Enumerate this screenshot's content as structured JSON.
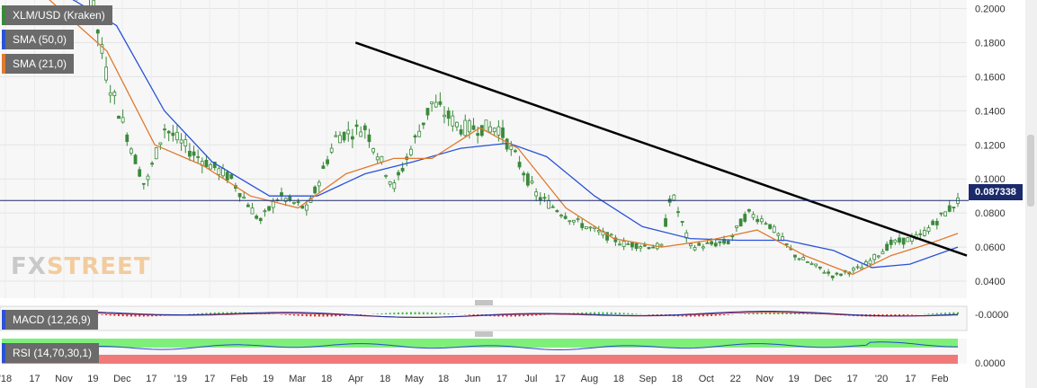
{
  "panel_labels": {
    "instrument": "XLM/USD (Kraken)",
    "sma50": "SMA (50,0)",
    "sma21": "SMA (21,0)",
    "macd": "MACD (12,26,9)",
    "rsi": "RSI (14,70,30,1)"
  },
  "colors": {
    "candle": "#3a8a3a",
    "sma50": "#2a52d8",
    "sma21": "#e07a2e",
    "trendline": "#000000",
    "price_line": "#1b2a6b",
    "macd_line": "#1a2aa0",
    "macd_signal": "#c83232",
    "macd_hist": "#36c13a",
    "rsi_line": "#2a4ad0",
    "rsi_upper_zone": "#7ef07a",
    "rsi_lower_zone": "#f07a7a"
  },
  "current_price": "0.087338",
  "logo": {
    "fx": "FX",
    "street": "STREET"
  },
  "chart_data": {
    "type": "candlestick",
    "title": "XLM/USD (Kraken)",
    "yaxis": {
      "ticks": [
        "0.2000",
        "0.1800",
        "0.1600",
        "0.1400",
        "0.1200",
        "0.1000",
        "0.0800",
        "0.0600",
        "0.0400"
      ],
      "ylim": [
        0.03,
        0.205
      ]
    },
    "xaxis": {
      "tick_labels": [
        "'18",
        "17",
        "Nov",
        "19",
        "Dec",
        "17",
        "'19",
        "17",
        "Feb",
        "19",
        "Mar",
        "18",
        "Apr",
        "18",
        "May",
        "18",
        "Jun",
        "17",
        "Jul",
        "17",
        "Aug",
        "18",
        "Sep",
        "18",
        "Oct",
        "22",
        "Nov",
        "19",
        "Dec",
        "17",
        "'20",
        "17",
        "Feb"
      ]
    },
    "approx_close_path": [
      {
        "x": 0.0,
        "y": 0.23
      },
      {
        "x": 0.09,
        "y": 0.215
      },
      {
        "x": 0.11,
        "y": 0.16
      },
      {
        "x": 0.15,
        "y": 0.095
      },
      {
        "x": 0.17,
        "y": 0.13
      },
      {
        "x": 0.2,
        "y": 0.115
      },
      {
        "x": 0.24,
        "y": 0.1
      },
      {
        "x": 0.27,
        "y": 0.075
      },
      {
        "x": 0.29,
        "y": 0.09
      },
      {
        "x": 0.32,
        "y": 0.082
      },
      {
        "x": 0.35,
        "y": 0.125
      },
      {
        "x": 0.38,
        "y": 0.13
      },
      {
        "x": 0.41,
        "y": 0.095
      },
      {
        "x": 0.45,
        "y": 0.145
      },
      {
        "x": 0.48,
        "y": 0.13
      },
      {
        "x": 0.52,
        "y": 0.13
      },
      {
        "x": 0.56,
        "y": 0.09
      },
      {
        "x": 0.6,
        "y": 0.075
      },
      {
        "x": 0.65,
        "y": 0.062
      },
      {
        "x": 0.69,
        "y": 0.06
      },
      {
        "x": 0.7,
        "y": 0.093
      },
      {
        "x": 0.72,
        "y": 0.06
      },
      {
        "x": 0.76,
        "y": 0.063
      },
      {
        "x": 0.78,
        "y": 0.08
      },
      {
        "x": 0.8,
        "y": 0.075
      },
      {
        "x": 0.83,
        "y": 0.055
      },
      {
        "x": 0.87,
        "y": 0.043
      },
      {
        "x": 0.9,
        "y": 0.048
      },
      {
        "x": 0.93,
        "y": 0.062
      },
      {
        "x": 0.96,
        "y": 0.066
      },
      {
        "x": 1.0,
        "y": 0.087
      }
    ],
    "sma50_path": [
      {
        "x": 0.0,
        "y": 0.23
      },
      {
        "x": 0.12,
        "y": 0.19
      },
      {
        "x": 0.17,
        "y": 0.14
      },
      {
        "x": 0.22,
        "y": 0.11
      },
      {
        "x": 0.28,
        "y": 0.09
      },
      {
        "x": 0.33,
        "y": 0.09
      },
      {
        "x": 0.38,
        "y": 0.103
      },
      {
        "x": 0.43,
        "y": 0.11
      },
      {
        "x": 0.48,
        "y": 0.118
      },
      {
        "x": 0.53,
        "y": 0.121
      },
      {
        "x": 0.57,
        "y": 0.113
      },
      {
        "x": 0.62,
        "y": 0.09
      },
      {
        "x": 0.67,
        "y": 0.072
      },
      {
        "x": 0.72,
        "y": 0.065
      },
      {
        "x": 0.77,
        "y": 0.064
      },
      {
        "x": 0.82,
        "y": 0.064
      },
      {
        "x": 0.87,
        "y": 0.058
      },
      {
        "x": 0.91,
        "y": 0.048
      },
      {
        "x": 0.95,
        "y": 0.05
      },
      {
        "x": 1.0,
        "y": 0.06
      }
    ],
    "sma21_path": [
      {
        "x": 0.0,
        "y": 0.23
      },
      {
        "x": 0.11,
        "y": 0.175
      },
      {
        "x": 0.16,
        "y": 0.12
      },
      {
        "x": 0.21,
        "y": 0.108
      },
      {
        "x": 0.26,
        "y": 0.09
      },
      {
        "x": 0.31,
        "y": 0.083
      },
      {
        "x": 0.36,
        "y": 0.103
      },
      {
        "x": 0.41,
        "y": 0.112
      },
      {
        "x": 0.45,
        "y": 0.112
      },
      {
        "x": 0.5,
        "y": 0.13
      },
      {
        "x": 0.54,
        "y": 0.118
      },
      {
        "x": 0.59,
        "y": 0.083
      },
      {
        "x": 0.64,
        "y": 0.065
      },
      {
        "x": 0.69,
        "y": 0.06
      },
      {
        "x": 0.74,
        "y": 0.064
      },
      {
        "x": 0.79,
        "y": 0.07
      },
      {
        "x": 0.84,
        "y": 0.055
      },
      {
        "x": 0.89,
        "y": 0.044
      },
      {
        "x": 0.93,
        "y": 0.055
      },
      {
        "x": 0.97,
        "y": 0.062
      },
      {
        "x": 1.0,
        "y": 0.068
      }
    ],
    "trendline": {
      "start": {
        "x": 0.37,
        "y": 0.18
      },
      "end": {
        "x": 1.0,
        "y": 0.055
      }
    },
    "horizontal_price_line": 0.0873,
    "macd": {
      "axis_label": "-0.0000"
    },
    "rsi": {
      "axis_label": "0.0000"
    }
  }
}
